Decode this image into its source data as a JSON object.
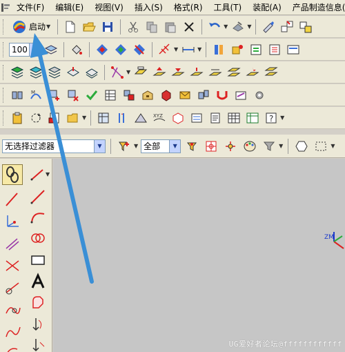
{
  "menubar": {
    "items": [
      "文件(F)",
      "编辑(E)",
      "视图(V)",
      "插入(S)",
      "格式(R)",
      "工具(T)",
      "装配(A)",
      "产品制造信息(M)"
    ]
  },
  "toolbar1": {
    "start_label": "启动",
    "icons": [
      "new-file-icon",
      "open-folder-icon",
      "save-icon",
      "cut-icon",
      "copy-icon",
      "paste-icon",
      "delete-icon",
      "undo-icon",
      "repeat-command-icon",
      "edit-object-display-icon",
      "wcs-icon",
      "show-hide-icon"
    ]
  },
  "toolbar2": {
    "zoom_value": "100"
  },
  "filter_bar": {
    "type_filter_value": "无选择过滤器",
    "scope_value": "全部"
  },
  "watermark": "UG爱好者论坛@ffffffffffff",
  "colors": {
    "menubar_bg": "#ece9d8",
    "canvas_bg": "#c6c6c6",
    "annotation_arrow": "#3a8fd6"
  }
}
